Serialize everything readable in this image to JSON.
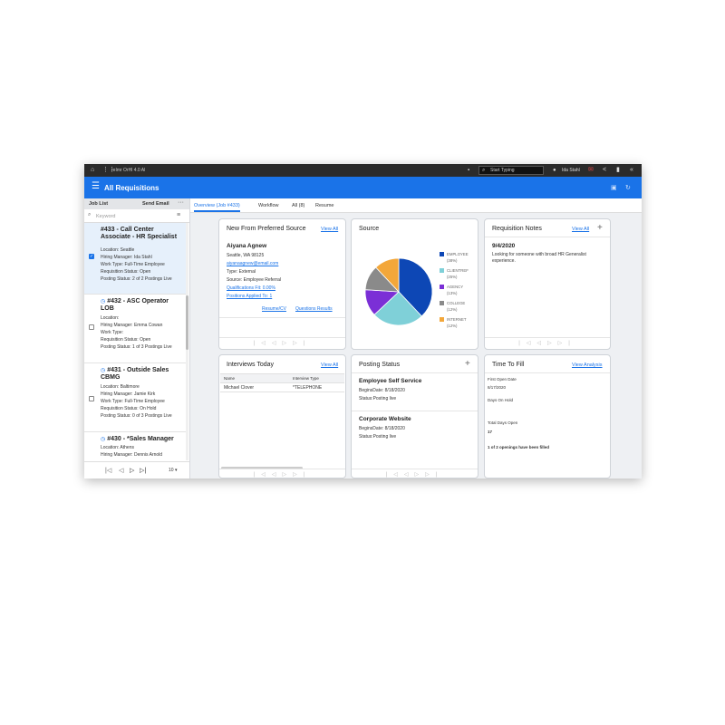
{
  "topbar": {
    "app_title": "reImr OrHl 4.0 Al",
    "search_placeholder": "Start Typing",
    "user_name": "Ida Stahl",
    "icons": [
      "home-icon",
      "apps-grid-icon",
      "notification-icon",
      "search-icon",
      "user-icon",
      "mail-icon",
      "share-icon",
      "bookmark-icon",
      "collapse-icon"
    ]
  },
  "header": {
    "title": "All Requisitions"
  },
  "left": {
    "job_list_label": "Job List",
    "send_email_label": "Send Email",
    "more_label": "···",
    "keyword_placeholder": "Keyword",
    "jobs": [
      {
        "title": "#433 - Call Center Associate - HR Specialist",
        "location": "Location: Seattle",
        "hiring_manager": "Hiring Manager: Ida Stahl",
        "work_type": "Work Type: Full-Time Employee",
        "status": "Requisition Status: Open",
        "postings": "Posting Status: 2 of 2 Postings Live",
        "selected": true
      },
      {
        "title": "#432 - ASC Operator LOB",
        "location": "Location:",
        "hiring_manager": "Hiring Manager: Emma Cowan",
        "work_type": "Work Type:",
        "status": "Requisition Status: Open",
        "postings": "Posting Status: 1 of 3 Postings Live",
        "selected": false
      },
      {
        "title": "#431 - Outside Sales CBMG",
        "location": "Location: Baltimore",
        "hiring_manager": "Hiring Manager: Jamie Kirk",
        "work_type": "Work Type: Full-Time Employee",
        "status": "Requisition Status: On Hold",
        "postings": "Posting Status: 0 of 3 Postings Live",
        "selected": false
      },
      {
        "title": "#430 - *Sales Manager",
        "location": "Location: Athens",
        "hiring_manager": "Hiring Manager: Dennis Arnold",
        "work_type": "",
        "status": "",
        "postings": "",
        "selected": false
      }
    ],
    "per_page": "10"
  },
  "tabs": [
    "Overview (Job #433)",
    "Workflow",
    "All (8)",
    "Resume"
  ],
  "cards": {
    "preferred": {
      "title": "New From Preferred Source",
      "view_all": "View All",
      "name": "Aiyana Agnew",
      "city": "Seattle, WA 98125",
      "email": "aiyanaagnew@email.com",
      "type": "Type: External",
      "source": "Source: Employee Referral",
      "qualifications": "Qualifications Fit: 0.00%",
      "positions": "Positions Applied To: 1",
      "resume_link": "Resume/CV",
      "questions_link": "Questions Results"
    },
    "source": {
      "title": "Source"
    },
    "notes": {
      "title": "Requisition Notes",
      "view_all": "View All",
      "date": "9/4/2020",
      "text_line1": "Looking for someone with broad HR Generalist",
      "text_line2": "experience."
    },
    "interviews": {
      "title": "Interviews Today",
      "view_all": "View All",
      "col_name": "Name",
      "col_type": "Interview Type",
      "rows": [
        {
          "name": "Michael Clover",
          "type": "*TELEPHONE"
        }
      ]
    },
    "posting": {
      "title": "Posting Status",
      "items": [
        {
          "name": "Employee Self Service",
          "begins": "BeginsDate: 8/18/2020",
          "status": "Status:Posting live"
        },
        {
          "name": "Corporate Website",
          "begins": "BeginsDate: 8/18/2020",
          "status": "Status:Posting live"
        }
      ]
    },
    "fill": {
      "title": "Time To Fill",
      "view_analysis": "View Analysis",
      "first_open_label": "First Open Date",
      "first_open_value": "8/17/2020",
      "days_on_hold_label": "Days On Hold",
      "total_days_label": "Total Days Open",
      "total_days_value": "17",
      "openings_text": "1 of 2 openings have been filled"
    }
  },
  "chart_data": {
    "type": "pie",
    "categories": [
      "EMPLOYEE",
      "CLIENTREF",
      "AGENCY",
      "COLLEGE",
      "INTERNET"
    ],
    "legend_labels": [
      [
        "EMPLOYEE",
        "(38%)"
      ],
      [
        "CLIENTREF",
        "(25%)"
      ],
      [
        "AGENCY",
        "(13%)"
      ],
      [
        "COLLEGE",
        "(12%)"
      ],
      [
        "INTERNET",
        "(12%)"
      ]
    ],
    "values": [
      38,
      25,
      13,
      12,
      12
    ],
    "colors": [
      "#0d47b5",
      "#7fd0d8",
      "#7b2fd6",
      "#8a8a8a",
      "#f3a73a"
    ],
    "legend": "right"
  }
}
